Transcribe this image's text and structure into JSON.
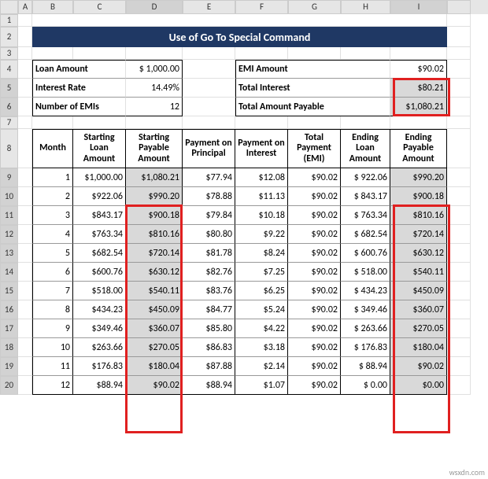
{
  "columns": [
    "A",
    "B",
    "C",
    "D",
    "E",
    "F",
    "G",
    "H",
    "I"
  ],
  "rows": [
    "1",
    "2",
    "3",
    "4",
    "5",
    "6",
    "7",
    "8",
    "9",
    "10",
    "11",
    "12",
    "13",
    "14",
    "15",
    "16",
    "17",
    "18",
    "19",
    "20"
  ],
  "title": "Use of Go To Special Command",
  "inputs_left": {
    "loan_amount_label": "Loan Amount",
    "loan_amount_value": "$ 1,000.00",
    "interest_rate_label": "Interest Rate",
    "interest_rate_value": "14.49%",
    "num_emis_label": "Number of EMIs",
    "num_emis_value": "12"
  },
  "inputs_right": {
    "emi_label": "EMI Amount",
    "emi_value": "$90.02",
    "total_interest_label": "Total Interest",
    "total_interest_value": "$80.21",
    "total_payable_label": "Total Amount Payable",
    "total_payable_value": "$1,080.21"
  },
  "table": {
    "headers": {
      "month": "Month",
      "start_loan": "Starting Loan Amount",
      "start_payable": "Starting Payable Amount",
      "pay_principal": "Payment on Principal",
      "pay_interest": "Payment on Interest",
      "total_payment": "Total Payment (EMI)",
      "end_loan": "Ending Loan Amount",
      "end_payable": "Ending Payable Amount"
    },
    "rows": [
      {
        "m": "1",
        "sl": "$1,000.00",
        "sp": "$1,080.21",
        "pp": "$77.94",
        "pi": "$12.08",
        "tp": "$90.02",
        "el": "$ 922.06",
        "ep": "$990.20"
      },
      {
        "m": "2",
        "sl": "$922.06",
        "sp": "$990.20",
        "pp": "$78.88",
        "pi": "$11.13",
        "tp": "$90.02",
        "el": "$ 843.17",
        "ep": "$900.18"
      },
      {
        "m": "3",
        "sl": "$843.17",
        "sp": "$900.18",
        "pp": "$79.84",
        "pi": "$10.18",
        "tp": "$90.02",
        "el": "$ 763.34",
        "ep": "$810.16"
      },
      {
        "m": "4",
        "sl": "$763.34",
        "sp": "$810.16",
        "pp": "$80.80",
        "pi": "$9.22",
        "tp": "$90.02",
        "el": "$ 682.54",
        "ep": "$720.14"
      },
      {
        "m": "5",
        "sl": "$682.54",
        "sp": "$720.14",
        "pp": "$81.78",
        "pi": "$8.24",
        "tp": "$90.02",
        "el": "$ 600.76",
        "ep": "$630.12"
      },
      {
        "m": "6",
        "sl": "$600.76",
        "sp": "$630.12",
        "pp": "$82.76",
        "pi": "$7.25",
        "tp": "$90.02",
        "el": "$ 518.00",
        "ep": "$540.11"
      },
      {
        "m": "7",
        "sl": "$518.00",
        "sp": "$540.11",
        "pp": "$83.76",
        "pi": "$6.25",
        "tp": "$90.02",
        "el": "$ 434.23",
        "ep": "$450.09"
      },
      {
        "m": "8",
        "sl": "$434.23",
        "sp": "$450.09",
        "pp": "$84.77",
        "pi": "$5.24",
        "tp": "$90.02",
        "el": "$ 349.46",
        "ep": "$360.07"
      },
      {
        "m": "9",
        "sl": "$349.46",
        "sp": "$360.07",
        "pp": "$85.80",
        "pi": "$4.22",
        "tp": "$90.02",
        "el": "$ 263.66",
        "ep": "$270.05"
      },
      {
        "m": "10",
        "sl": "$263.66",
        "sp": "$270.05",
        "pp": "$86.83",
        "pi": "$3.18",
        "tp": "$90.02",
        "el": "$ 176.83",
        "ep": "$180.04"
      },
      {
        "m": "11",
        "sl": "$176.83",
        "sp": "$180.04",
        "pp": "$87.88",
        "pi": "$2.14",
        "tp": "$90.02",
        "el": "$   88.94",
        "ep": "$90.02"
      },
      {
        "m": "12",
        "sl": "$88.94",
        "sp": "$90.02",
        "pp": "$88.94",
        "pi": "$1.07",
        "tp": "$90.02",
        "el": "$     0.00",
        "ep": "$0.00"
      }
    ]
  },
  "watermark": "wsxdn.com",
  "row_heights": {
    "default": 24,
    "r1": 16,
    "r2": 26,
    "r3": 16,
    "r7": 16,
    "r8": 50
  },
  "chart_data": {
    "type": "table",
    "title": "Use of Go To Special Command",
    "loan_parameters": {
      "Loan Amount": 1000.0,
      "Interest Rate": 0.1449,
      "Number of EMIs": 12,
      "EMI Amount": 90.02,
      "Total Interest": 80.21,
      "Total Amount Payable": 1080.21
    },
    "columns": [
      "Month",
      "Starting Loan Amount",
      "Starting Payable Amount",
      "Payment on Principal",
      "Payment on Interest",
      "Total Payment (EMI)",
      "Ending Loan Amount",
      "Ending Payable Amount"
    ],
    "rows": [
      [
        1,
        1000.0,
        1080.21,
        77.94,
        12.08,
        90.02,
        922.06,
        990.2
      ],
      [
        2,
        922.06,
        990.2,
        78.88,
        11.13,
        90.02,
        843.17,
        900.18
      ],
      [
        3,
        843.17,
        900.18,
        79.84,
        10.18,
        90.02,
        763.34,
        810.16
      ],
      [
        4,
        763.34,
        810.16,
        80.8,
        9.22,
        90.02,
        682.54,
        720.14
      ],
      [
        5,
        682.54,
        720.14,
        81.78,
        8.24,
        90.02,
        600.76,
        630.12
      ],
      [
        6,
        600.76,
        630.12,
        82.76,
        7.25,
        90.02,
        518.0,
        540.11
      ],
      [
        7,
        518.0,
        540.11,
        83.76,
        6.25,
        90.02,
        434.23,
        450.09
      ],
      [
        8,
        434.23,
        450.09,
        84.77,
        5.24,
        90.02,
        349.46,
        360.07
      ],
      [
        9,
        349.46,
        360.07,
        85.8,
        4.22,
        90.02,
        263.66,
        270.05
      ],
      [
        10,
        263.66,
        270.05,
        86.83,
        3.18,
        90.02,
        176.83,
        180.04
      ],
      [
        11,
        176.83,
        180.04,
        87.88,
        2.14,
        90.02,
        88.94,
        90.02
      ],
      [
        12,
        88.94,
        90.02,
        88.94,
        1.07,
        90.02,
        0.0,
        0.0
      ]
    ]
  }
}
